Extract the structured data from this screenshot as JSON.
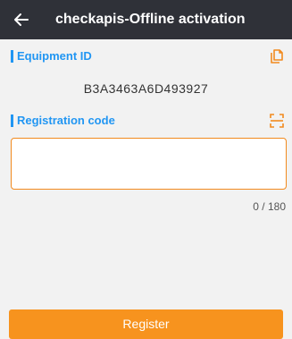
{
  "header": {
    "title": "checkapis-Offline activation",
    "back_icon": "arrow-left-icon",
    "background": "#2f3138"
  },
  "equipment": {
    "label": "Equipment ID",
    "value": "B3A3463A6D493927",
    "action_icon": "copy-icon"
  },
  "registration": {
    "label": "Registration code",
    "value": "",
    "placeholder": "",
    "counter": "0 / 180",
    "action_icon": "scan-icon"
  },
  "actions": {
    "register_label": "Register"
  },
  "colors": {
    "accent": "#2196f3",
    "primary_button": "#f7931e",
    "input_border": "#f28a1e"
  }
}
